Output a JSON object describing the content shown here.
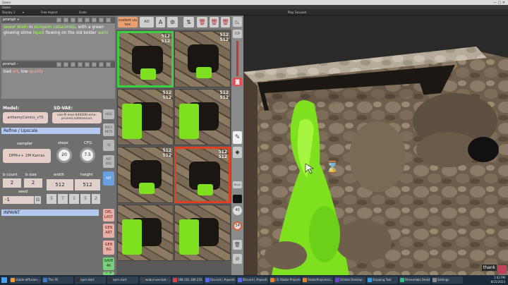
{
  "window": {
    "title": "Game",
    "unity_tab": "Game",
    "toolbar": {
      "display": "Display 1",
      "aspect": "Free Aspect",
      "scale_label": "Scale",
      "focused": "Play Focused"
    }
  },
  "prompt_positive": {
    "header": "prompt +",
    "text_parts": [
      {
        "t": "sewer drain",
        "c": "green"
      },
      {
        "t": " in ",
        "c": "white"
      },
      {
        "t": "dungeon catacombs",
        "c": "green"
      },
      {
        "t": ", with a green glowing slime ",
        "c": "white"
      },
      {
        "t": "liquid",
        "c": "green"
      },
      {
        "t": " flowing on the old bolder ",
        "c": "white"
      },
      {
        "t": "walls",
        "c": "green"
      }
    ]
  },
  "prompt_negative": {
    "header": "prompt –",
    "text_parts": [
      {
        "t": "bad ",
        "c": "white"
      },
      {
        "t": "art",
        "c": "red"
      },
      {
        "t": ", low ",
        "c": "white"
      },
      {
        "t": "quality",
        "c": "red"
      }
    ]
  },
  "model": {
    "label": "Model:",
    "value": "arthemyComics_v70"
  },
  "sd_vae": {
    "label": "SD-VAE:",
    "value": "vae-ft-mse-840000-ema-pruned.safetensors"
  },
  "refine_bar": "Refine / Upscale",
  "sampler": {
    "label": "sampler",
    "value": "DPM++ 2M Karras"
  },
  "steps": {
    "label": "steps",
    "value": "20"
  },
  "cfg": {
    "label": "CFG",
    "value": "7.5"
  },
  "batch": {
    "count_label": "b count",
    "size_label": "b size",
    "count": "2",
    "size": "2"
  },
  "dims": {
    "width_label": "width",
    "height_label": "height",
    "width": "512",
    "height": "512"
  },
  "seed": {
    "label": "seed",
    "value": "-1",
    "presets": [
      "5",
      "7",
      "1",
      "5",
      "2"
    ]
  },
  "inpaint_bar": "INPAINT",
  "side_buttons": {
    "hide": "HIDE",
    "prev_nets": "PREV NETS",
    "td": "3D",
    "art_bg": "ART (BG)",
    "art": "ART",
    "del_last": "DEL LAST",
    "gen_art": "GEN ART",
    "gen_bg": "GEN BG",
    "save_4k": "SAVE 4K"
  },
  "mid_toolbar": {
    "custom_tex": "custom uv tex",
    "ao": "AO"
  },
  "thumbs": [
    {
      "w": "512",
      "h": "512",
      "state": "selected"
    },
    {
      "w": "512",
      "h": "512",
      "state": ""
    },
    {
      "w": "512",
      "h": "512",
      "state": ""
    },
    {
      "w": "512",
      "h": "512",
      "state": ""
    },
    {
      "w": "512",
      "h": "512",
      "state": ""
    },
    {
      "w": "512",
      "h": "512",
      "state": "active"
    },
    {
      "w": "",
      "h": "",
      "state": ""
    },
    {
      "w": "",
      "h": "",
      "state": ""
    }
  ],
  "tool_col": {
    "top": "TOP",
    "brush": "Brush",
    "forty": "40",
    "thirtyfour": "34"
  },
  "overlay": "thank",
  "taskbar": [
    "stable-diffusion-...",
    "This PC",
    "npm start",
    "npm start",
    "webui-user.bat - ...",
    "198.181.180.216...",
    "Discord | #questi...",
    "Discord | #questi...",
    "(3) Stable Projector...",
    "StableProjectorz...",
    "GitHub Desktop",
    "Snipping Tool",
    "Streamlabs Deskt...",
    "Settings"
  ],
  "clock": {
    "time": "1:02 PM",
    "date": "8/25/2023"
  },
  "colors": {
    "accent_green": "#3ad040",
    "accent_red": "#e04020",
    "slime": "#7fe020",
    "panel": "#6f6f6f"
  }
}
